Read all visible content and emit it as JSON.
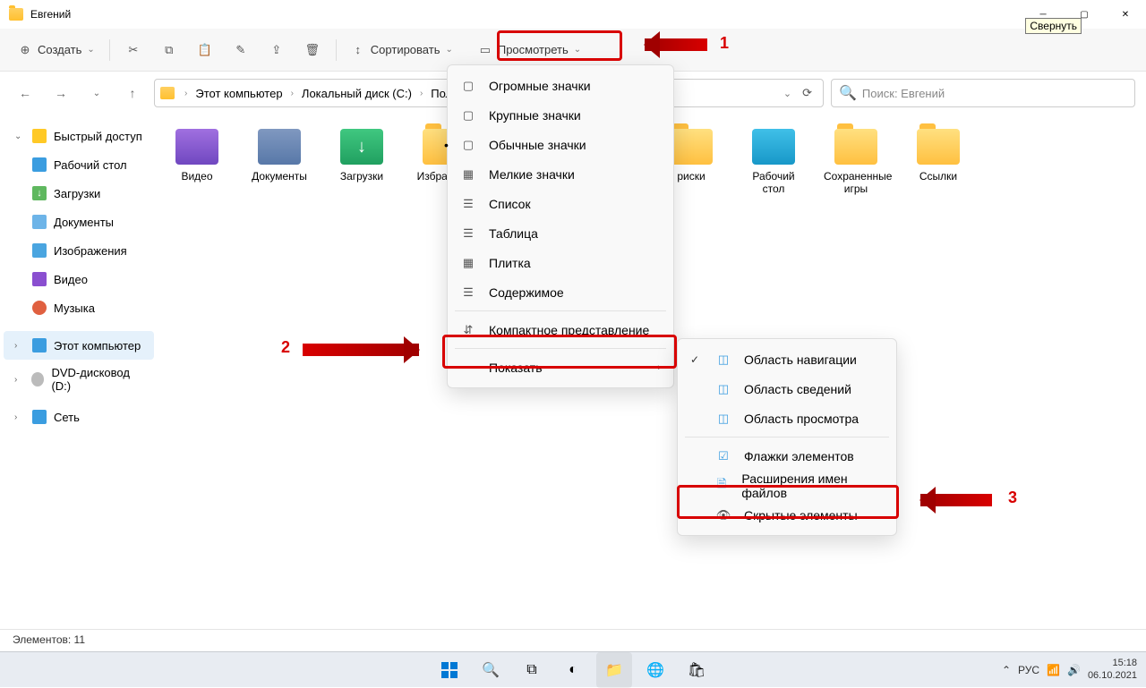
{
  "title": "Евгений",
  "tooltip": "Свернуть",
  "toolbar": {
    "create": "Создать",
    "sort": "Сортировать",
    "view": "Просмотреть"
  },
  "breadcrumb": [
    "Этот компьютер",
    "Локальный диск (C:)",
    "Пользоват"
  ],
  "search_placeholder": "Поиск: Евгений",
  "sidebar": {
    "quick": "Быстрый доступ",
    "desktop": "Рабочий стол",
    "downloads": "Загрузки",
    "documents": "Документы",
    "images": "Изображения",
    "videos": "Видео",
    "music": "Музыка",
    "pc": "Этот компьютер",
    "dvd": "DVD-дисковод (D:)",
    "network": "Сеть"
  },
  "items": {
    "videos": "Видео",
    "docs": "Документы",
    "downloads": "Загрузки",
    "favorites": "Избранное",
    "disks": "риски",
    "desktop": "Рабочий стол",
    "saved_games": "Сохраненные игры",
    "links": "Ссылки"
  },
  "menu1": {
    "huge": "Огромные значки",
    "large": "Крупные значки",
    "normal": "Обычные значки",
    "small": "Мелкие значки",
    "list": "Список",
    "table": "Таблица",
    "tiles": "Плитка",
    "content": "Содержимое",
    "compact": "Компактное представление",
    "show": "Показать"
  },
  "menu2": {
    "nav": "Область навигации",
    "details": "Область сведений",
    "preview": "Область просмотра",
    "checkboxes": "Флажки элементов",
    "extensions": "Расширения имен файлов",
    "hidden": "Скрытые элементы"
  },
  "annotations": {
    "n1": "1",
    "n2": "2",
    "n3": "3"
  },
  "status": "Элементов: 11",
  "taskbar": {
    "lang": "РУС",
    "time": "15:18",
    "date": "06.10.2021"
  }
}
